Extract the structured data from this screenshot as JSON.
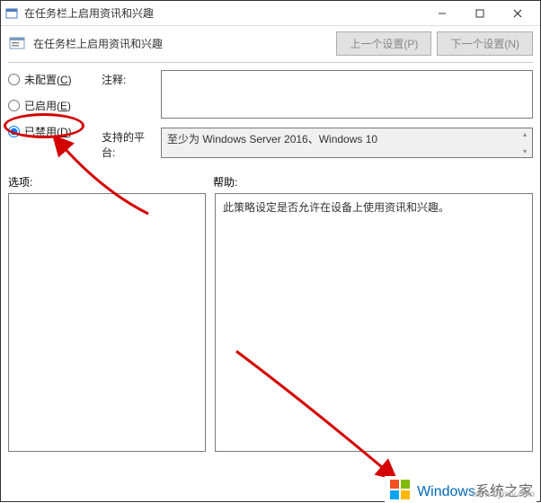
{
  "window": {
    "title": "在任务栏上启用资讯和兴趣"
  },
  "toolbar": {
    "title": "在任务栏上启用资讯和兴趣",
    "prev_label": "上一个设置(P)",
    "next_label": "下一个设置(N)"
  },
  "radios": {
    "not_configured": "未配置(C)",
    "enabled": "已启用(E)",
    "disabled": "已禁用(D)",
    "selected": "disabled"
  },
  "form": {
    "comment_label": "注释:",
    "comment_value": "",
    "platform_label": "支持的平台:",
    "platform_value": "至少为 Windows Server 2016、Windows 10"
  },
  "sections": {
    "options_label": "选项:",
    "help_label": "帮助:",
    "help_text": "此策略设定是否允许在设备上使用资讯和兴趣。"
  },
  "watermark": {
    "brand": "Windows",
    "suffix": "系统之家",
    "url": "www.bjjmlv.com"
  }
}
